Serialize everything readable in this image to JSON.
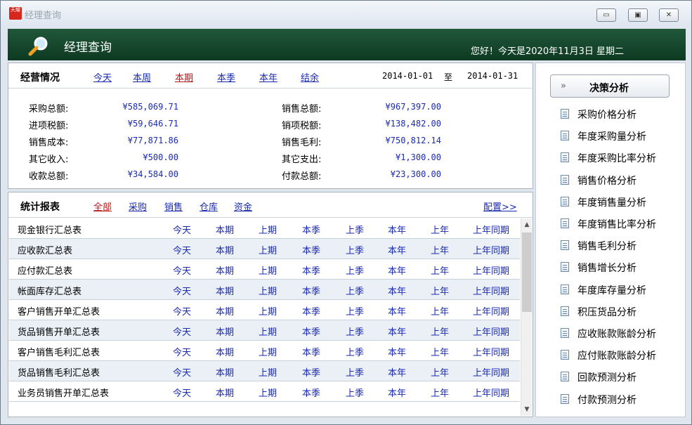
{
  "window": {
    "title": "经理查询",
    "icon_text": "天耀"
  },
  "header": {
    "title": "经理查询",
    "greeting": "您好！今天是2020年11月3日 星期二"
  },
  "operations": {
    "title": "经营情况",
    "periods": [
      "今天",
      "本周",
      "本期",
      "本季",
      "本年",
      "结余"
    ],
    "active_period": "本期",
    "date_from": "2014-01-01",
    "date_sep": "至",
    "date_to": "2014-01-31",
    "left_items": [
      {
        "label": "采购总额:",
        "value": "¥585,069.71"
      },
      {
        "label": "进项税额:",
        "value": "¥59,646.71"
      },
      {
        "label": "销售成本:",
        "value": "¥77,871.86"
      },
      {
        "label": "其它收入:",
        "value": "¥500.00"
      },
      {
        "label": "收款总额:",
        "value": "¥34,584.00"
      }
    ],
    "right_items": [
      {
        "label": "销售总额:",
        "value": "¥967,397.00"
      },
      {
        "label": "销项税额:",
        "value": "¥138,482.00"
      },
      {
        "label": "销售毛利:",
        "value": "¥750,812.14"
      },
      {
        "label": "其它支出:",
        "value": "¥1,300.00"
      },
      {
        "label": "付款总额:",
        "value": "¥23,300.00"
      }
    ]
  },
  "reports": {
    "title": "统计报表",
    "filters": [
      "全部",
      "采购",
      "销售",
      "仓库",
      "资金"
    ],
    "active_filter": "全部",
    "config_label": "配置>>",
    "period_links": [
      "今天",
      "本期",
      "上期",
      "本季",
      "上季",
      "本年",
      "上年",
      "上年同期"
    ],
    "rows": [
      "现金银行汇总表",
      "应收款汇总表",
      "应付款汇总表",
      "帐面库存汇总表",
      "客户销售开单汇总表",
      "货品销售开单汇总表",
      "客户销售毛利汇总表",
      "货品销售毛利汇总表",
      "业务员销售开单汇总表"
    ]
  },
  "analysis": {
    "button_arrow": "»",
    "button_label": "决策分析",
    "items": [
      "采购价格分析",
      "年度采购量分析",
      "年度采购比率分析",
      "销售价格分析",
      "年度销售量分析",
      "年度销售比率分析",
      "销售毛利分析",
      "销售增长分析",
      "年度库存量分析",
      "积压货品分析",
      "应收账款账龄分析",
      "应付账款账龄分析",
      "回款预测分析",
      "付款预测分析"
    ]
  }
}
